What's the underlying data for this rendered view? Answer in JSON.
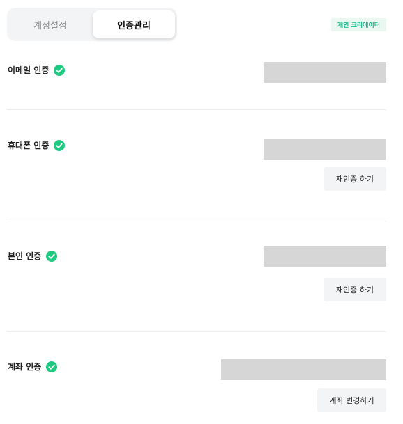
{
  "tabs": {
    "account_settings": "계정설정",
    "verification_management": "인증관리"
  },
  "creator_badge": "개인 크리에이터",
  "sections": {
    "email": {
      "title": "이메일 인증"
    },
    "phone": {
      "title": "휴대폰 인증",
      "button": "재인증 하기"
    },
    "identity": {
      "title": "본인 인증",
      "button": "재인증 하기"
    },
    "bank": {
      "title": "계좌 인증",
      "button": "계좌 변경하기"
    }
  },
  "colors": {
    "accent": "#12B886",
    "check_bg": "#20C980",
    "masked_value": "#D6D6D6",
    "button_bg": "#F3F4F5"
  },
  "icons": {
    "verified": "check-circle-icon"
  }
}
